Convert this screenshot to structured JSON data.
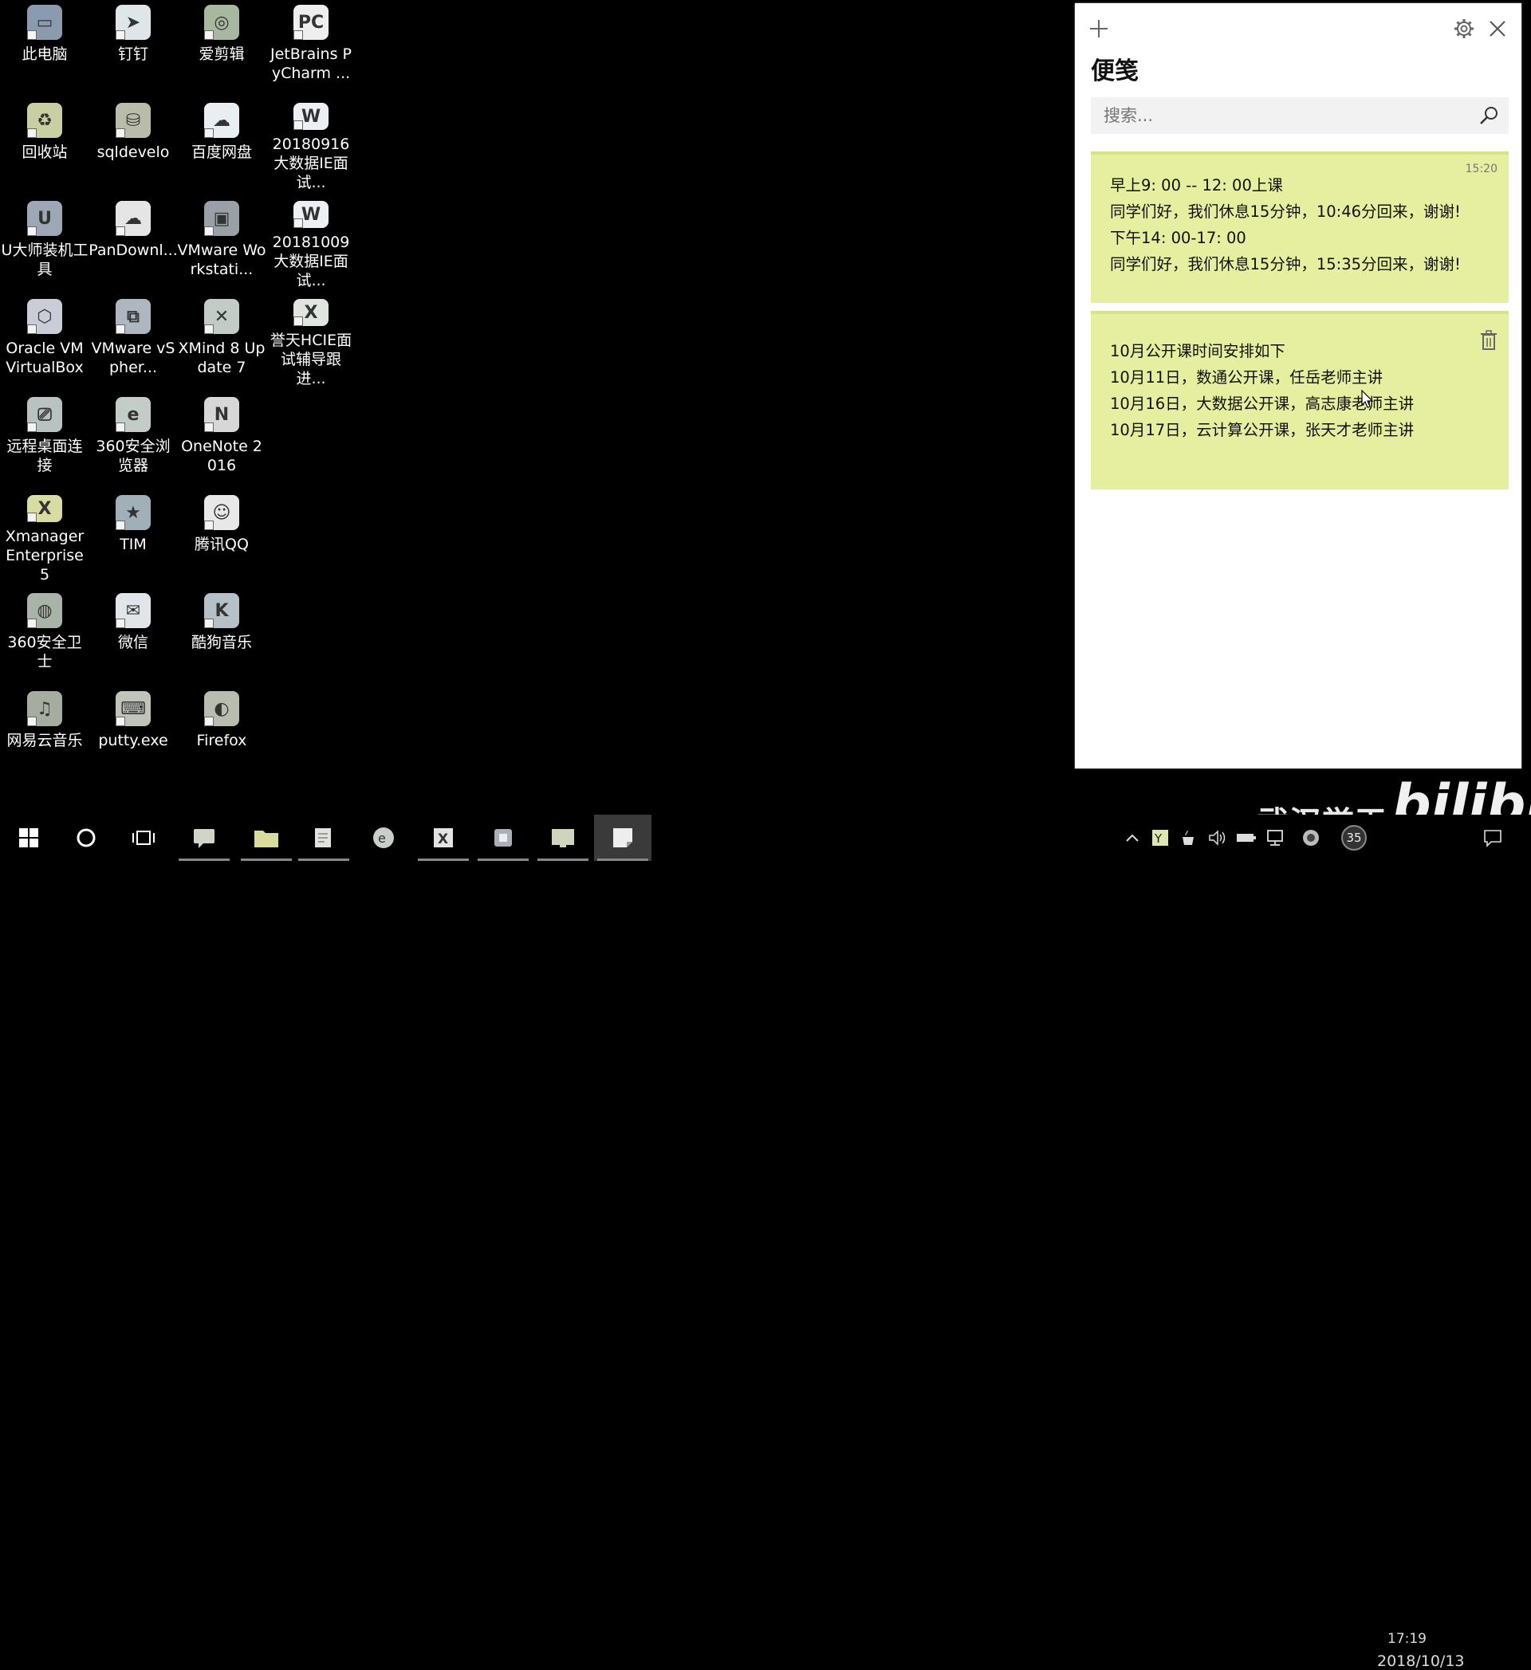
{
  "desktop": {
    "icons": [
      {
        "label": "此电脑",
        "icon": "this-pc-icon",
        "color": "#8a9bb0",
        "glyph": "▭"
      },
      {
        "label": "钉钉",
        "icon": "dingtalk-icon",
        "color": "#dfe6ea",
        "glyph": "➤"
      },
      {
        "label": "爱剪辑",
        "icon": "aijianji-icon",
        "color": "#a8b7a0",
        "glyph": "◎"
      },
      {
        "label": "JetBrains PyCharm ...",
        "icon": "pycharm-icon",
        "color": "#eeeeee",
        "glyph": "PC"
      },
      {
        "label": "回收站",
        "icon": "recycle-bin-icon",
        "color": "#c9cfa0",
        "glyph": "♻"
      },
      {
        "label": "sqldevelo",
        "icon": "sqldeveloper-icon",
        "color": "#b8bca8",
        "glyph": "⛁"
      },
      {
        "label": "百度网盘",
        "icon": "baidu-netdisk-icon",
        "color": "#e9eef3",
        "glyph": "☁"
      },
      {
        "label": "20180916大数据IE面试...",
        "icon": "word-doc-icon",
        "color": "#ecf0f4",
        "glyph": "W"
      },
      {
        "label": "U大师装机工具",
        "icon": "udashi-icon",
        "color": "#9da7b5",
        "glyph": "U"
      },
      {
        "label": "PanDownl...",
        "icon": "pandownload-icon",
        "color": "#e5e5e5",
        "glyph": "☁"
      },
      {
        "label": "VMware Workstati...",
        "icon": "vmware-workstation-icon",
        "color": "#9aa0a8",
        "glyph": "▣"
      },
      {
        "label": "20181009大数据IE面试...",
        "icon": "word-doc-icon",
        "color": "#ecf0f4",
        "glyph": "W"
      },
      {
        "label": "Oracle VM VirtualBox",
        "icon": "virtualbox-icon",
        "color": "#c9ced6",
        "glyph": "⬡"
      },
      {
        "label": "VMware vSpher...",
        "icon": "vsphere-icon",
        "color": "#aeb6c0",
        "glyph": "⧉"
      },
      {
        "label": "XMind 8 Update 7",
        "icon": "xmind-icon",
        "color": "#c3cbc6",
        "glyph": "✕"
      },
      {
        "label": "誉天HCIE面试辅导跟进...",
        "icon": "excel-doc-icon",
        "color": "#dfe6df",
        "glyph": "X"
      },
      {
        "label": "远程桌面连接",
        "icon": "remote-desktop-icon",
        "color": "#b8c2c0",
        "glyph": "⎚"
      },
      {
        "label": "360安全浏览器",
        "icon": "360-browser-icon",
        "color": "#c4ccc8",
        "glyph": "e"
      },
      {
        "label": "OneNote 2016",
        "icon": "onenote-icon",
        "color": "#d7d7d7",
        "glyph": "N"
      },
      {
        "label": "Xmanager Enterprise 5",
        "icon": "xmanager-icon",
        "color": "#d8dca0",
        "glyph": "X"
      },
      {
        "label": "TIM",
        "icon": "tim-icon",
        "color": "#9fb0b8",
        "glyph": "★"
      },
      {
        "label": "腾讯QQ",
        "icon": "qq-icon",
        "color": "#e8e8e8",
        "glyph": "☺"
      },
      {
        "label": "360安全卫士",
        "icon": "360-security-icon",
        "color": "#a9b4a8",
        "glyph": "◍"
      },
      {
        "label": "微信",
        "icon": "wechat-icon",
        "color": "#dfe5e8",
        "glyph": "✉"
      },
      {
        "label": "酷狗音乐",
        "icon": "kugou-icon",
        "color": "#b5c0c8",
        "glyph": "K"
      },
      {
        "label": "网易云音乐",
        "icon": "netease-music-icon",
        "color": "#a4ad9f",
        "glyph": "♫"
      },
      {
        "label": "putty.exe",
        "icon": "putty-icon",
        "color": "#c0c4b8",
        "glyph": "⌨"
      },
      {
        "label": "Firefox",
        "icon": "firefox-icon",
        "color": "#b9bdb0",
        "glyph": "◐"
      }
    ]
  },
  "notes_app": {
    "title": "便笺",
    "search_placeholder": "搜索...",
    "accent_color": "#e6eea0",
    "notes": [
      {
        "time": "15:20",
        "lines": [
          "早上9: 00 -- 12: 00上课",
          "同学们好，我们休息15分钟，10:46分回来，谢谢!",
          "下午14: 00-17: 00",
          "同学们好，我们休息15分钟，15:35分回来，谢谢!"
        ]
      },
      {
        "lines": [
          "10月公开课时间安排如下",
          "",
          "10月11日，数通公开课，任岳老师主讲",
          "10月16日，大数据公开课，高志康老师主讲",
          "10月17日，云计算公开课，张天才老师主讲"
        ]
      }
    ]
  },
  "taskbar": {
    "tray_badge": "35",
    "clock_time": "17:19",
    "clock_date": "2018/10/13"
  },
  "watermark": {
    "text": "武汉誉天",
    "logo": "bilibili"
  }
}
